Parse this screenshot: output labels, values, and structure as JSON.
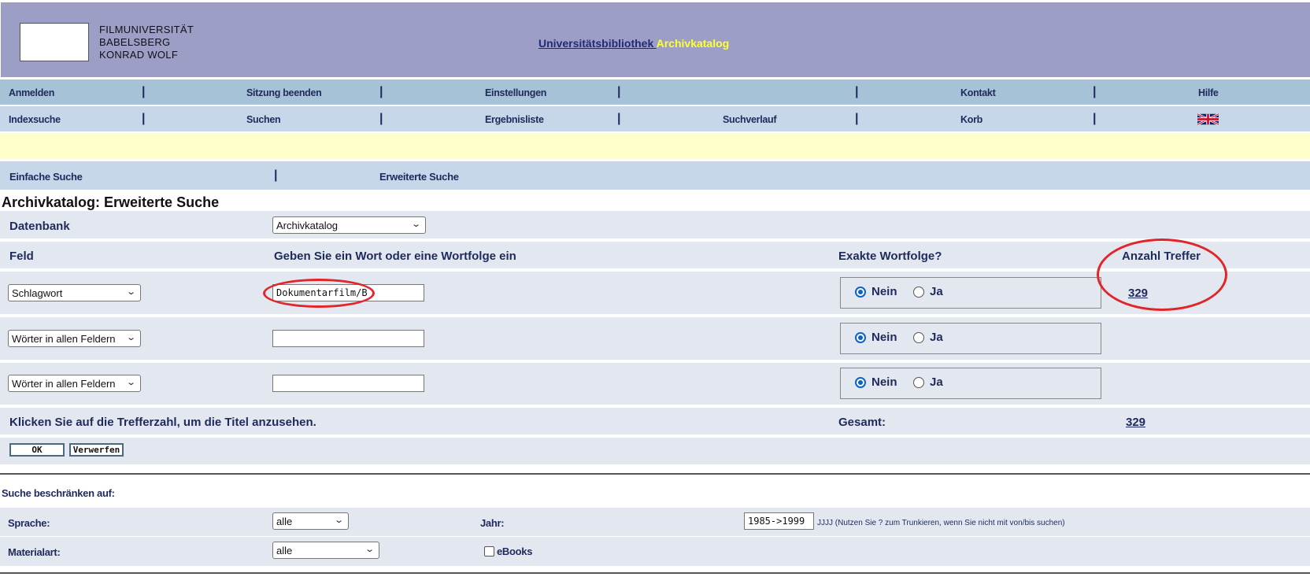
{
  "header": {
    "logo_lines": [
      "FILMUNIVERSITÄT",
      "BABELSBERG",
      "KONRAD WOLF"
    ],
    "library_link": "Universitätsbibliothek ",
    "catalog_link": "Archivkatalog"
  },
  "nav1": {
    "items": [
      "Anmelden",
      "Sitzung beenden",
      "Einstellungen",
      "",
      "Kontakt",
      "Hilfe"
    ],
    "separator": "|"
  },
  "nav2": {
    "items": [
      "Indexsuche",
      "Suchen",
      "Ergebnisliste",
      "Suchverlauf",
      "Korb"
    ],
    "separator": "|",
    "language_icon": "uk-flag-icon"
  },
  "subtabs": {
    "simple": "Einfache Suche",
    "separator": "|",
    "advanced": "Erweiterte Suche"
  },
  "page_title": "Archivkatalog: Erweiterte Suche",
  "form": {
    "database_label": "Datenbank",
    "database_value": "Archivkatalog",
    "col_field": "Feld",
    "col_words": "Geben Sie ein Wort oder eine Wortfolge ein",
    "col_exact": "Exakte Wortfolge?",
    "col_hits": "Anzahl Treffer",
    "rows": [
      {
        "field": "Schlagwort",
        "value": "Dokumentarfilm/B",
        "no": "Nein",
        "yes": "Ja",
        "selected": "Nein",
        "hits": "329"
      },
      {
        "field": "Wörter in allen Feldern",
        "value": "",
        "no": "Nein",
        "yes": "Ja",
        "selected": "Nein",
        "hits": ""
      },
      {
        "field": "Wörter in allen Feldern",
        "value": "",
        "no": "Nein",
        "yes": "Ja",
        "selected": "Nein",
        "hits": ""
      }
    ],
    "click_hint": "Klicken Sie auf die Trefferzahl, um die Titel anzusehen.",
    "total_label": "Gesamt:",
    "total_value": "329",
    "ok_button": "OK",
    "reset_button": "Verwerfen"
  },
  "restrict": {
    "title": "Suche beschränken auf:",
    "language_label": "Sprache:",
    "language_value": "alle",
    "year_label": "Jahr:",
    "year_value": "1985->1999",
    "year_hint": "JJJJ (Nutzen Sie ? zum Trunkieren, wenn Sie nicht mit von/bis suchen)",
    "material_label": "Materialart:",
    "material_value": "alle",
    "ebooks_label": "eBooks",
    "ebooks_checked": false
  },
  "colors": {
    "header_bg": "#9d9ec5",
    "nav1_bg": "#a6c2d6",
    "nav2_bg": "#c5d7e8",
    "highlight_bg": "#ffffcc",
    "form_bg": "#e3e8f0",
    "text": "#1f2a5c",
    "annotation": "#e0262a"
  }
}
